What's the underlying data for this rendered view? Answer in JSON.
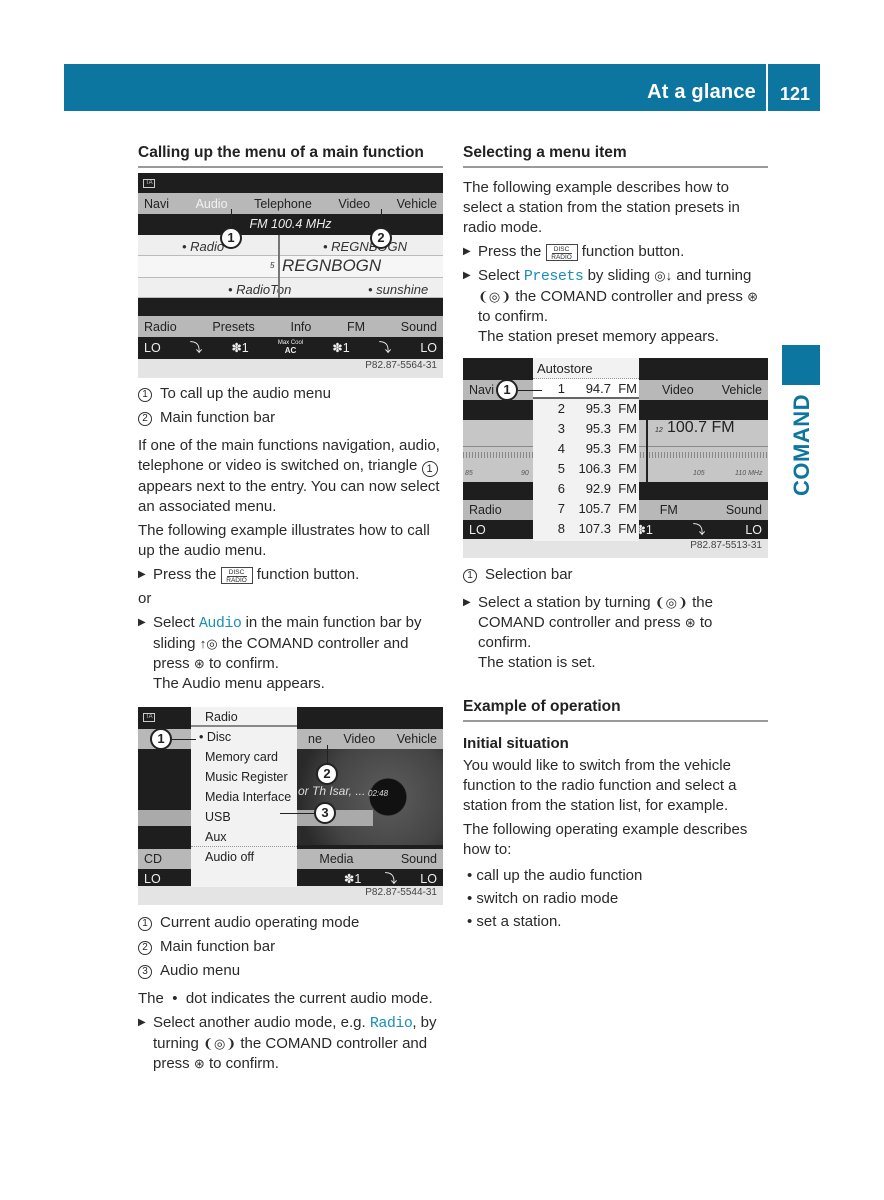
{
  "header": {
    "section_title": "At a glance",
    "page_number": "121"
  },
  "side_tab": {
    "label": "COMAND"
  },
  "left": {
    "heading": "Calling up the menu of a main function",
    "screen1": {
      "ta_icon": "TA",
      "main_bar": [
        "Navi",
        "Audio",
        "Telephone",
        "Video",
        "Vehicle"
      ],
      "frequency": "FM 100.4 MHz",
      "stations": {
        "r1_left": "• Radio",
        "r1_right": "• REGNBOGN",
        "r2_num": "5",
        "r2_center": "REGNBOGN",
        "r3_left": "• RadioTon",
        "r3_right": "• sunshine"
      },
      "func_bar": [
        "Radio",
        "Presets",
        "Info",
        "FM",
        "Sound"
      ],
      "climate": {
        "left_temp": "LO",
        "fan_left": "✽1",
        "ac_top": "Max Cool",
        "ac": "AC",
        "fan_right": "✽1",
        "right_temp": "LO"
      },
      "callouts": [
        "1",
        "2"
      ],
      "image_id": "P82.87-5564-31"
    },
    "legend1": [
      {
        "n": "1",
        "text": "To call up the audio menu"
      },
      {
        "n": "2",
        "text": "Main function bar"
      }
    ],
    "para1a": "If one of the main functions navigation, audio, telephone or video is switched on, triangle",
    "para1b": "appears next to the entry. You can now select an associated menu.",
    "para1_num": "1",
    "para2": "The following example illustrates how to call up the audio menu.",
    "step1_pre": "Press the",
    "step1_post": "function button.",
    "button_top": "DISC",
    "button_bottom": "RADIO",
    "or": "or",
    "step2_pre": "Select",
    "step2_kw": "Audio",
    "step2_post": "in the main function bar by sliding",
    "step2_glyph": "↑◎",
    "step2_post2": "the COMAND controller and press",
    "press_glyph": "⊛",
    "step2_post3": "to confirm.",
    "step2_result": "The Audio menu appears.",
    "screen2": {
      "ta_icon": "TA",
      "menu_items": [
        "Radio",
        "• Disc",
        "Memory card",
        "Music Register",
        "Media Interface",
        "USB",
        "Aux",
        "Audio off"
      ],
      "main_bar_visible": [
        "ne",
        "Video",
        "Vehicle"
      ],
      "track": "or Th  Isar, ...",
      "time": "02:48",
      "func_left": "CD",
      "func_bar_visible": [
        "Media",
        "Sound"
      ],
      "climate": {
        "left_temp": "LO",
        "fan": "✽1",
        "right_temp": "LO"
      },
      "callouts": [
        "1",
        "2",
        "3"
      ],
      "image_id": "P82.87-5544-31"
    },
    "legend2": [
      {
        "n": "1",
        "text": "Current audio operating mode"
      },
      {
        "n": "2",
        "text": "Main function bar"
      },
      {
        "n": "3",
        "text": "Audio menu"
      }
    ],
    "dot_para_pre": "The",
    "dot_para_dot": "•",
    "dot_para_post": "dot indicates the current audio mode.",
    "step3_pre": "Select another audio mode, e.g.",
    "step3_kw": "Radio",
    "step3_post": ", by turning",
    "turn_glyph": "❨◎❩",
    "step3_post2": "the COMAND controller and press",
    "step3_post3": "to confirm."
  },
  "right": {
    "heading": "Selecting a menu item",
    "para1": "The following example describes how to select a station from the station presets in radio mode.",
    "step1_pre": "Press the",
    "step1_post": "function button.",
    "button_top": "DISC",
    "button_bottom": "RADIO",
    "step2_pre": "Select",
    "step2_kw": "Presets",
    "step2_post": "by sliding",
    "slide_glyph": "◎↓",
    "step2_post2": "and turning",
    "turn_glyph": "❨◎❩",
    "step2_post3": "the COMAND controller and press",
    "press_glyph": "⊛",
    "step2_post4": "to confirm.",
    "step2_result": "The station preset memory appears.",
    "screen3": {
      "main_bar_left": "Navi",
      "main_bar_right": [
        "Video",
        "Vehicle"
      ],
      "list_header": "Autostore",
      "presets": [
        {
          "n": "1",
          "freq": "94.7",
          "band": "FM"
        },
        {
          "n": "2",
          "freq": "95.3",
          "band": "FM"
        },
        {
          "n": "3",
          "freq": "95.3",
          "band": "FM"
        },
        {
          "n": "4",
          "freq": "95.3",
          "band": "FM"
        },
        {
          "n": "5",
          "freq": "106.3",
          "band": "FM"
        },
        {
          "n": "6",
          "freq": "92.9",
          "band": "FM"
        },
        {
          "n": "7",
          "freq": "105.7",
          "band": "FM"
        },
        {
          "n": "8",
          "freq": "107.3",
          "band": "FM"
        }
      ],
      "current_num": "12",
      "current": "100.7 FM",
      "scale_left": [
        "85",
        "90"
      ],
      "scale_right": [
        "105",
        "110 MHz"
      ],
      "func_left": "Radio",
      "func_right": [
        "FM",
        "Sound"
      ],
      "climate": {
        "left_temp": "LO",
        "fan": "✽1",
        "right_temp": "LO"
      },
      "callouts": [
        "1"
      ],
      "image_id": "P82.87-5513-31"
    },
    "legend3": [
      {
        "n": "1",
        "text": "Selection bar"
      }
    ],
    "step3_pre": "Select a station by turning",
    "step3_post": "the COMAND controller and press",
    "step3_post2": "to confirm.",
    "step3_result": "The station is set.",
    "heading2": "Example of operation",
    "subheading": "Initial situation",
    "para2": "You would like to switch from the vehicle function to the radio function and select a station from the station list, for example.",
    "para3": "The following operating example describes how to:",
    "bullets": [
      "• call up the audio function",
      "• switch on radio mode",
      "• set a station."
    ]
  }
}
